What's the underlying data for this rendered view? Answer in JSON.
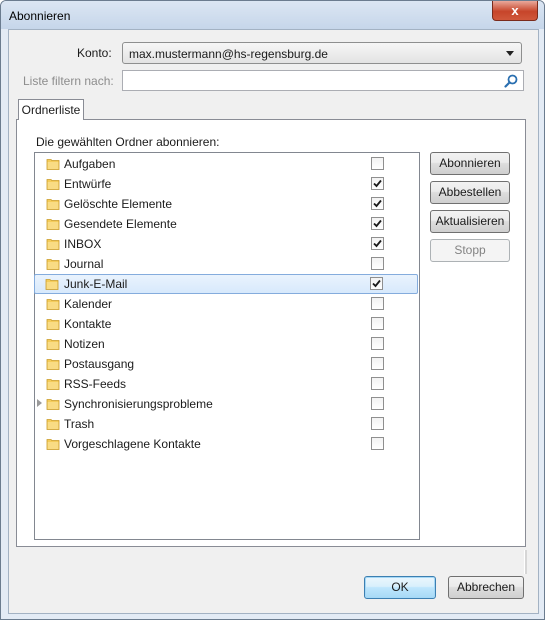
{
  "window": {
    "title": "Abonnieren",
    "close_label": "x"
  },
  "account": {
    "label": "Konto:",
    "value": "max.mustermann@hs-regensburg.de"
  },
  "filter": {
    "label": "Liste filtern nach:",
    "value": "",
    "placeholder": ""
  },
  "tab": {
    "label": "Ordnerliste"
  },
  "list_caption": "Die gewählten Ordner abonnieren:",
  "folders": [
    {
      "name": "Aufgaben",
      "subscribed": false
    },
    {
      "name": "Entwürfe",
      "subscribed": true
    },
    {
      "name": "Gelöschte Elemente",
      "subscribed": true
    },
    {
      "name": "Gesendete Elemente",
      "subscribed": true
    },
    {
      "name": "INBOX",
      "subscribed": true
    },
    {
      "name": "Journal",
      "subscribed": false
    },
    {
      "name": "Junk-E-Mail",
      "subscribed": true,
      "selected": true
    },
    {
      "name": "Kalender",
      "subscribed": false
    },
    {
      "name": "Kontakte",
      "subscribed": false
    },
    {
      "name": "Notizen",
      "subscribed": false
    },
    {
      "name": "Postausgang",
      "subscribed": false
    },
    {
      "name": "RSS-Feeds",
      "subscribed": false
    },
    {
      "name": "Synchronisierungsprobleme",
      "subscribed": false,
      "has_children": true
    },
    {
      "name": "Trash",
      "subscribed": false
    },
    {
      "name": "Vorgeschlagene Kontakte",
      "subscribed": false
    }
  ],
  "side_buttons": {
    "subscribe": "Abonnieren",
    "unsubscribe": "Abbestellen",
    "refresh": "Aktualisieren",
    "stop": "Stopp"
  },
  "footer": {
    "ok": "OK",
    "cancel": "Abbrechen"
  },
  "colors": {
    "selection": "#d7e9fc",
    "folder": "#f4cc5a",
    "accent": "#3c7fb1"
  }
}
